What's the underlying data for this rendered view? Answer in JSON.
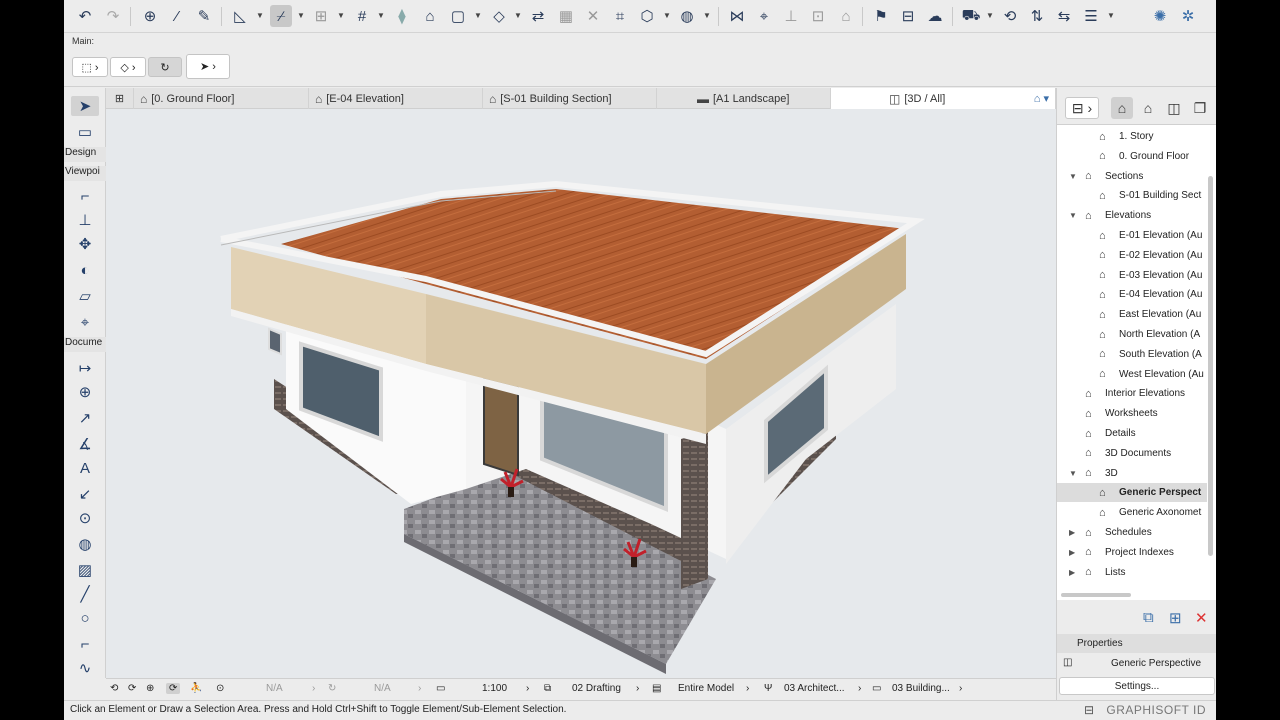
{
  "toolbar": {
    "icons": [
      "undo-icon",
      "redo-icon",
      "find-select-icon",
      "pick-up-icon",
      "inject-icon",
      "guide-line-icon",
      "snap-guides-icon",
      "trace-icon",
      "grid-snap-icon",
      "layer-icon",
      "suspend-groups-icon",
      "view-options-icon",
      "renovation-icon",
      "graphic-override-icon",
      "partial-structure-icon",
      "element-transfer-icon",
      "pen-set-icon",
      "explode-icon",
      "magic-wand-icon",
      "align-icon",
      "distribute-icon",
      "elevation-marker-icon",
      "flag-icon",
      "publish-icon",
      "teamwork-icon",
      "bim-cloud-icon",
      "manage-icon",
      "sync-icon",
      "refresh-icon",
      "globe-icon"
    ]
  },
  "info_box": {
    "main_label": "Main:"
  },
  "toolbox": {
    "categories": [
      "Design",
      "Viewpoi",
      "Docume"
    ]
  },
  "tabs": [
    {
      "label": "[0. Ground Floor]",
      "icon": "floor-plan-icon"
    },
    {
      "label": "[E-04 Elevation]",
      "icon": "elevation-icon"
    },
    {
      "label": "[S-01 Building Section]",
      "icon": "section-icon"
    },
    {
      "label": "[A1 Landscape]",
      "icon": "layout-icon"
    },
    {
      "label": "[3D / All]",
      "icon": "3d-view-icon"
    }
  ],
  "navigator": {
    "tree": [
      {
        "label": "1. Story",
        "level": 3,
        "icon": "story-icon",
        "arrow": ""
      },
      {
        "label": "0. Ground Floor",
        "level": 3,
        "icon": "story-icon",
        "arrow": ""
      },
      {
        "label": "Sections",
        "level": 2,
        "icon": "section-folder-icon",
        "arrow": "▼"
      },
      {
        "label": "S-01 Building Sect",
        "level": 3,
        "icon": "section-icon",
        "arrow": ""
      },
      {
        "label": "Elevations",
        "level": 2,
        "icon": "elevation-folder-icon",
        "arrow": "▼"
      },
      {
        "label": "E-01 Elevation (Au",
        "level": 3,
        "icon": "elevation-icon",
        "arrow": ""
      },
      {
        "label": "E-02 Elevation (Au",
        "level": 3,
        "icon": "elevation-icon",
        "arrow": ""
      },
      {
        "label": "E-03 Elevation (Au",
        "level": 3,
        "icon": "elevation-icon",
        "arrow": ""
      },
      {
        "label": "E-04 Elevation (Au",
        "level": 3,
        "icon": "elevation-icon",
        "arrow": ""
      },
      {
        "label": "East Elevation (Au",
        "level": 3,
        "icon": "elevation-icon",
        "arrow": ""
      },
      {
        "label": "North Elevation (A",
        "level": 3,
        "icon": "elevation-icon",
        "arrow": ""
      },
      {
        "label": "South Elevation (A",
        "level": 3,
        "icon": "elevation-icon",
        "arrow": ""
      },
      {
        "label": "West Elevation (Au",
        "level": 3,
        "icon": "elevation-icon",
        "arrow": ""
      },
      {
        "label": "Interior Elevations",
        "level": 2,
        "icon": "interior-elevation-icon",
        "arrow": ""
      },
      {
        "label": "Worksheets",
        "level": 2,
        "icon": "worksheet-icon",
        "arrow": ""
      },
      {
        "label": "Details",
        "level": 2,
        "icon": "detail-icon",
        "arrow": ""
      },
      {
        "label": "3D Documents",
        "level": 2,
        "icon": "3d-document-icon",
        "arrow": ""
      },
      {
        "label": "3D",
        "level": 2,
        "icon": "3d-icon",
        "arrow": "▼"
      },
      {
        "label": "Generic Perspect",
        "level": 3,
        "icon": "perspective-icon",
        "arrow": "",
        "selected": true
      },
      {
        "label": "Generic Axonomet",
        "level": 3,
        "icon": "axonometry-icon",
        "arrow": ""
      },
      {
        "label": "Schedules",
        "level": 2,
        "icon": "schedule-icon",
        "arrow": "▶"
      },
      {
        "label": "Project Indexes",
        "level": 2,
        "icon": "project-index-icon",
        "arrow": "▶"
      },
      {
        "label": "Lists",
        "level": 2,
        "icon": "list-icon",
        "arrow": "▶"
      }
    ]
  },
  "properties": {
    "header": "Properties",
    "view_name": "Generic Perspective",
    "settings_label": "Settings..."
  },
  "statusbar": {
    "na1": "N/A",
    "na2": "N/A",
    "scale": "1:100",
    "pen_set": "02 Drafting",
    "model_filter": "Entire Model",
    "mvo": "03 Architect...",
    "dimension": "03 Building..."
  },
  "message": "Click an Element or Draw a Selection Area. Press and Hold Ctrl+Shift to Toggle Element/Sub-Element Selection.",
  "brand": "GRAPHISOFT ID"
}
